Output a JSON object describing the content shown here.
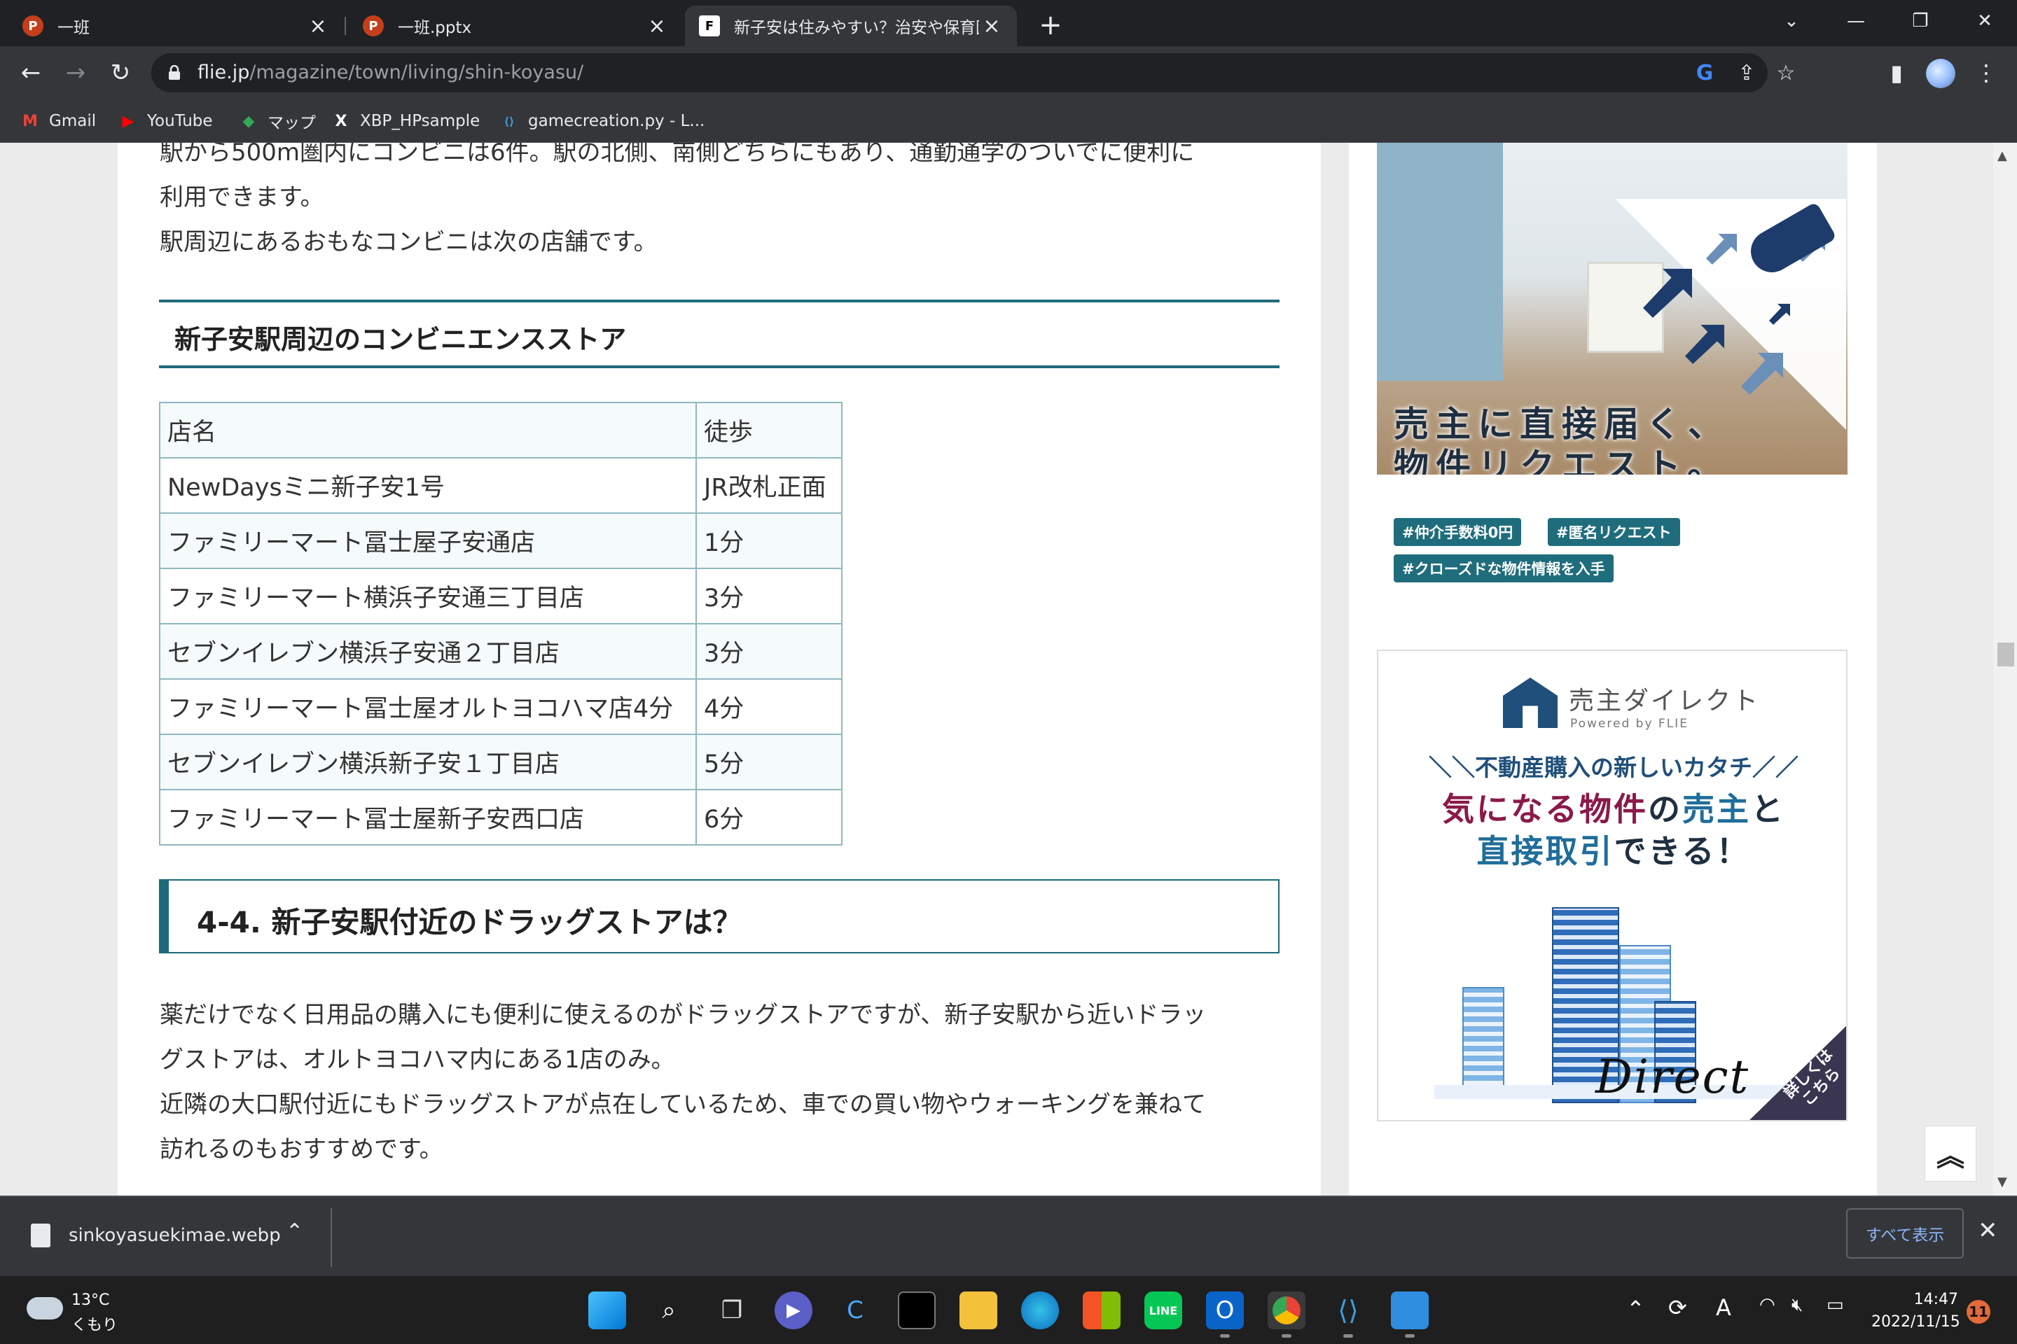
{
  "tabs": [
    {
      "title": "一班",
      "icon": "P"
    },
    {
      "title": "一班.pptx",
      "icon": "P"
    },
    {
      "title": "新子安は住みやすい？治安や保育園",
      "icon": "F"
    }
  ],
  "toolbar": {
    "url_host": "flie.jp",
    "url_path": "/magazine/town/living/shin-koyasu/"
  },
  "bookmarks": [
    {
      "label": "Gmail",
      "icon": "M"
    },
    {
      "label": "YouTube",
      "icon": "▶"
    },
    {
      "label": "マップ",
      "icon": "◆"
    },
    {
      "label": "XBP_HPsample",
      "icon": "X"
    },
    {
      "label": "gamecreation.py - L...",
      "icon": "⟨⟩"
    }
  ],
  "article": {
    "para1_line1": "駅から500m圏内にコンビニは6件。駅の北側、南側どちらにもあり、通勤通学のついでに便利に",
    "para1_line2": "利用できます。",
    "para1_line3": "駅周辺にあるおもなコンビニは次の店舗です。",
    "conv_heading": "新子安駅周辺のコンビニエンスストア",
    "table_header": [
      "店名",
      "徒歩"
    ],
    "table_rows": [
      [
        "NewDaysミニ新子安1号",
        "JR改札正面"
      ],
      [
        "ファミリーマート冨士屋子安通店",
        "1分"
      ],
      [
        "ファミリーマート横浜子安通三丁目店",
        "3分"
      ],
      [
        "セブンイレブン横浜子安通２丁目店",
        "3分"
      ],
      [
        "ファミリーマート冨士屋オルトヨコハマ店4分",
        "4分"
      ],
      [
        "セブンイレブン横浜新子安１丁目店",
        "5分"
      ],
      [
        "ファミリーマート冨士屋新子安西口店",
        "6分"
      ]
    ],
    "drug_heading": "4-4. 新子安駅付近のドラッグストアは？",
    "para2_line1": "薬だけでなく日用品の購入にも便利に使えるのがドラッグストアですが、新子安駅から近いドラッ",
    "para2_line2": "グストアは、オルトヨコハマ内にある1店のみ。",
    "para2_line3": "近隣の大口駅付近にもドラッグストアが点在しているため、車での買い物やウォーキングを兼ねて",
    "para2_line4": "訪れるのもおすすめです。"
  },
  "sidebar": {
    "ad1_line1": "売主に直接届く、",
    "ad1_line2": "物件リクエスト。",
    "ad1_tags": [
      "#仲介手数料0円",
      "#匿名リクエスト",
      "#クローズドな物件情報を入手"
    ],
    "ad2_brand": "売主ダイレクト",
    "ad2_powered": "Powered by FLIE",
    "ad2_tagline": "＼＼不動産購入の新しいカタチ／／",
    "ad2_h1a": "気になる物件",
    "ad2_h1b": "の",
    "ad2_h1c": "売主",
    "ad2_h1d": "と",
    "ad2_h2a": "直接取引",
    "ad2_h2b": "できる！",
    "ad2_logo": "Direct",
    "ad2_corner": "詳しくは\nこちら"
  },
  "download": {
    "filename": "sinkoyasuekimae.webp",
    "show_all": "すべて表示"
  },
  "taskbar": {
    "temp": "13°C",
    "weather": "くもり",
    "time": "14:47",
    "date": "2022/11/15",
    "notifications": "11",
    "ime": "A"
  },
  "colors": {
    "accent_teal": "#1e6a7a",
    "chrome_dark": "#202124",
    "chrome_toolbar": "#35363a"
  }
}
